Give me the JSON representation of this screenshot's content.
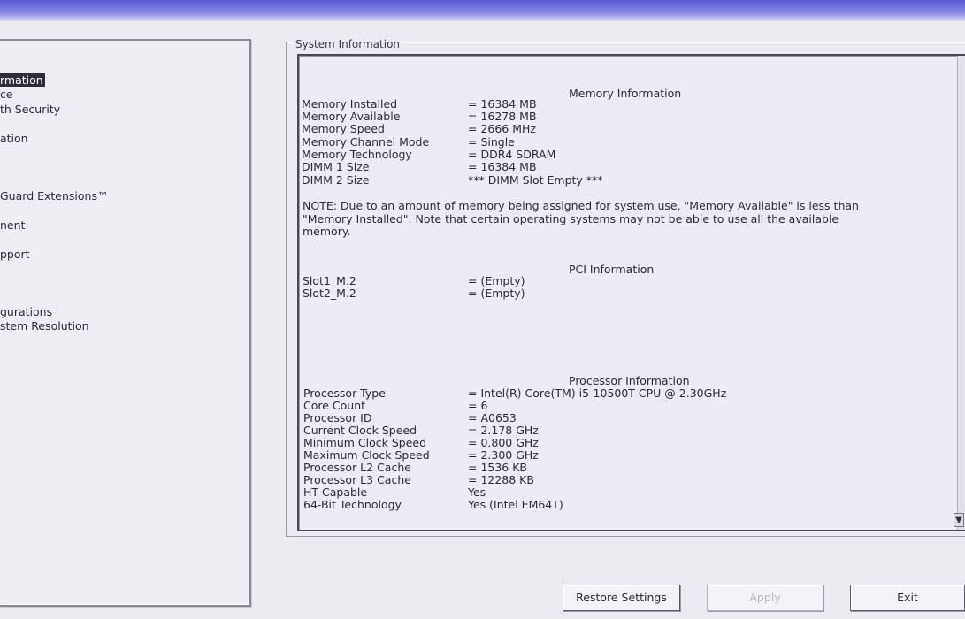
{
  "sidebar": {
    "items": [
      {
        "label": "rmation",
        "selected": true
      },
      {
        "label": "ce"
      },
      {
        "label": "th Security"
      },
      {
        "label": "ation"
      },
      {
        "label": "Guard Extensions™"
      },
      {
        "label": "nent"
      },
      {
        "label": "pport"
      },
      {
        "label": "gurations"
      },
      {
        "label": "stem Resolution"
      }
    ]
  },
  "main": {
    "group_title": "System Information",
    "memory": {
      "heading": "Memory Information",
      "rows": [
        {
          "label": "Memory Installed",
          "value": "= 16384 MB"
        },
        {
          "label": "Memory Available",
          "value": "= 16278 MB"
        },
        {
          "label": "Memory Speed",
          "value": "= 2666 MHz"
        },
        {
          "label": "Memory Channel Mode",
          "value": "= Single"
        },
        {
          "label": "Memory Technology",
          "value": "= DDR4 SDRAM"
        },
        {
          "label": "DIMM 1 Size",
          "value": "= 16384 MB"
        },
        {
          "label": "DIMM 2 Size",
          "value": "*** DIMM Slot Empty ***"
        }
      ],
      "note": "NOTE: Due to an amount of memory being assigned for system use, \"Memory Available\" is less than \"Memory Installed\". Note that certain operating systems may not be able to use all the available memory."
    },
    "pci": {
      "heading": "PCI Information",
      "rows": [
        {
          "label": "Slot1_M.2",
          "value": "= (Empty)"
        },
        {
          "label": "Slot2_M.2",
          "value": "= (Empty)"
        }
      ]
    },
    "processor": {
      "heading": "Processor Information",
      "rows": [
        {
          "label": "Processor Type",
          "value": "= Intel(R) Core(TM) i5-10500T CPU @ 2.30GHz"
        },
        {
          "label": "Core Count",
          "value": "= 6"
        },
        {
          "label": "Processor ID",
          "value": "= A0653"
        },
        {
          "label": "Current Clock Speed",
          "value": "= 2.178 GHz"
        },
        {
          "label": "Minimum Clock Speed",
          "value": "= 0.800 GHz"
        },
        {
          "label": "Maximum Clock Speed",
          "value": "= 2.300 GHz"
        },
        {
          "label": "Processor L2 Cache",
          "value": "= 1536 KB"
        },
        {
          "label": "Processor L3 Cache",
          "value": "= 12288 KB"
        },
        {
          "label": "HT Capable",
          "value": "Yes"
        },
        {
          "label": "64-Bit Technology",
          "value": "Yes (Intel EM64T)"
        }
      ]
    }
  },
  "buttons": {
    "restore_label": "Restore Settings",
    "apply_label": "Apply",
    "exit_label": "Exit"
  },
  "icons": {
    "scroll_arrow": "chevron-down-icon"
  }
}
